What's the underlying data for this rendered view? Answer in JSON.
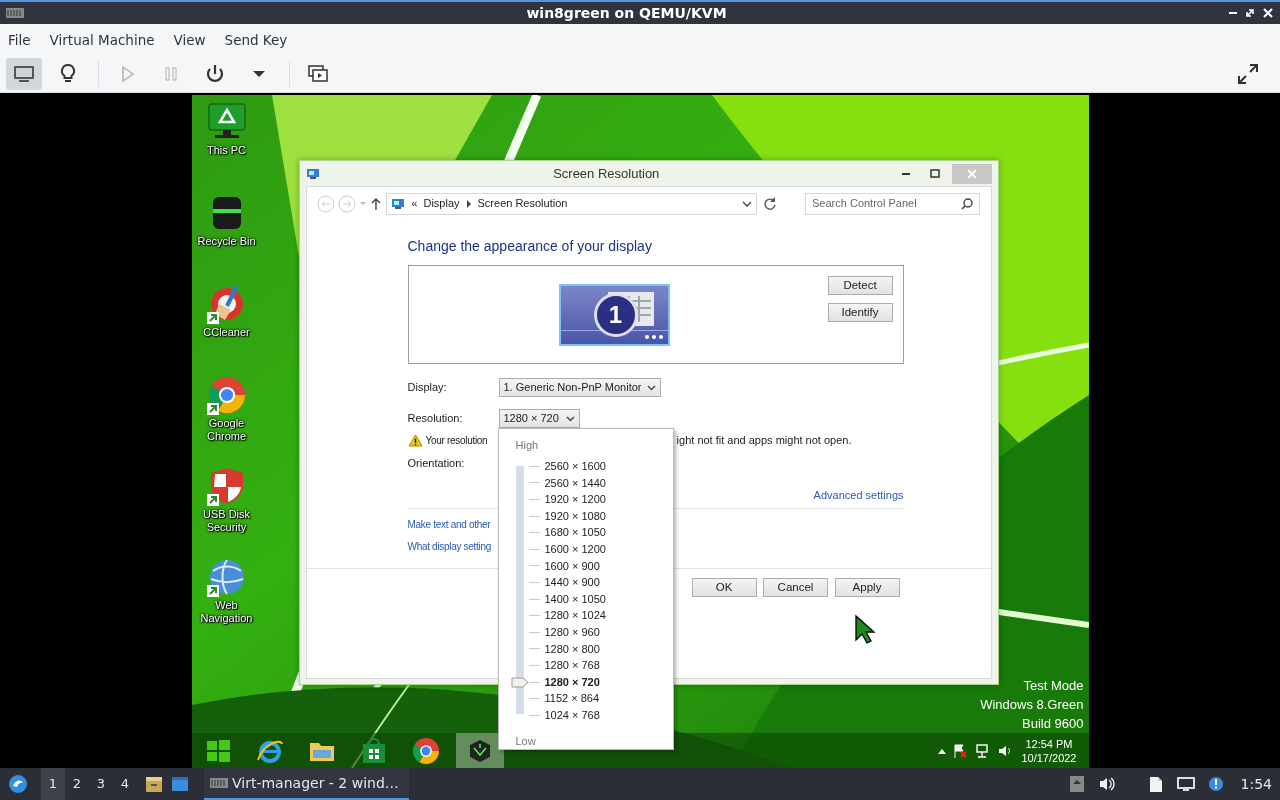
{
  "window": {
    "title": "win8green on QEMU/KVM"
  },
  "menu": [
    "File",
    "Virtual Machine",
    "View",
    "Send Key"
  ],
  "toolbar_groups": [
    [
      {
        "kind": "console",
        "selected": true,
        "disabled": false
      },
      {
        "kind": "details",
        "selected": false,
        "disabled": false
      }
    ],
    [
      {
        "kind": "run",
        "selected": false,
        "disabled": true
      },
      {
        "kind": "pause",
        "selected": false,
        "disabled": true
      },
      {
        "kind": "power",
        "selected": false,
        "disabled": false
      },
      {
        "kind": "power-menu",
        "selected": false,
        "disabled": false
      }
    ],
    [
      {
        "kind": "snapshots",
        "selected": false,
        "disabled": false
      }
    ]
  ],
  "toolbar_end": [
    {
      "kind": "fullscreen",
      "selected": false,
      "disabled": false
    }
  ],
  "desktop_icons": [
    {
      "kind": "pc",
      "label": "This PC"
    },
    {
      "kind": "recycle",
      "label": "Recycle Bin"
    },
    {
      "kind": "ccleaner",
      "label": "CCleaner"
    },
    {
      "kind": "chrome",
      "label": "Google Chrome"
    },
    {
      "kind": "shield",
      "label": "USB Disk Security"
    },
    {
      "kind": "globe",
      "label": "Web Navigation"
    }
  ],
  "dialog": {
    "title": "Screen Resolution",
    "breadcrumb_prefix": "«",
    "breadcrumb": [
      "Display",
      "Screen Resolution"
    ],
    "search_placeholder": "Search Control Panel",
    "heading": "Change the appearance of your display",
    "monitor_number": "1",
    "side_buttons": [
      "Detect",
      "Identify"
    ],
    "display_label": "Display:",
    "display_value": "1. Generic Non-PnP Monitor",
    "resolution_label": "Resolution:",
    "resolution_value": "1280 × 720",
    "warning_start": "Your resolution",
    "warning_end": "ight not fit and apps might not open.",
    "orientation_label": "Orientation:",
    "advanced_link": "Advanced settings",
    "links": [
      "Make text and other",
      "What display setting"
    ],
    "buttons": [
      "OK",
      "Cancel",
      "Apply"
    ]
  },
  "resolution_menu": {
    "high": "High",
    "low": "Low",
    "options": [
      {
        "label": "2560 × 1600",
        "selected": false
      },
      {
        "label": "2560 × 1440",
        "selected": false
      },
      {
        "label": "1920 × 1200",
        "selected": false
      },
      {
        "label": "1920 × 1080",
        "selected": false
      },
      {
        "label": "1680 × 1050",
        "selected": false
      },
      {
        "label": "1600 × 1200",
        "selected": false
      },
      {
        "label": "1600 × 900",
        "selected": false
      },
      {
        "label": "1440 × 900",
        "selected": false
      },
      {
        "label": "1400 × 1050",
        "selected": false
      },
      {
        "label": "1280 × 1024",
        "selected": false
      },
      {
        "label": "1280 × 960",
        "selected": false
      },
      {
        "label": "1280 × 800",
        "selected": false
      },
      {
        "label": "1280 × 768",
        "selected": false
      },
      {
        "label": "1280 × 720",
        "selected": true
      },
      {
        "label": "1152 × 864",
        "selected": false
      },
      {
        "label": "1024 × 768",
        "selected": false
      }
    ]
  },
  "system_notice": [
    "Test Mode",
    "Windows 8.Green",
    "Build 9600"
  ],
  "win_taskbar": {
    "apps": [
      {
        "kind": "start",
        "selected": false
      },
      {
        "kind": "ie",
        "selected": false
      },
      {
        "kind": "explorer",
        "selected": false
      },
      {
        "kind": "store",
        "selected": false
      },
      {
        "kind": "chrome",
        "selected": false
      },
      {
        "kind": "vm-app",
        "selected": true
      }
    ],
    "time": "12:54 PM",
    "date": "10/17/2022"
  },
  "panel": {
    "workspaces": [
      {
        "label": "1",
        "selected": true
      },
      {
        "label": "2",
        "selected": false
      },
      {
        "label": "3",
        "selected": false
      },
      {
        "label": "4",
        "selected": false
      }
    ],
    "task": {
      "label": "Virt-manager - 2 wind…",
      "selected": true
    },
    "clock": "1:54"
  }
}
